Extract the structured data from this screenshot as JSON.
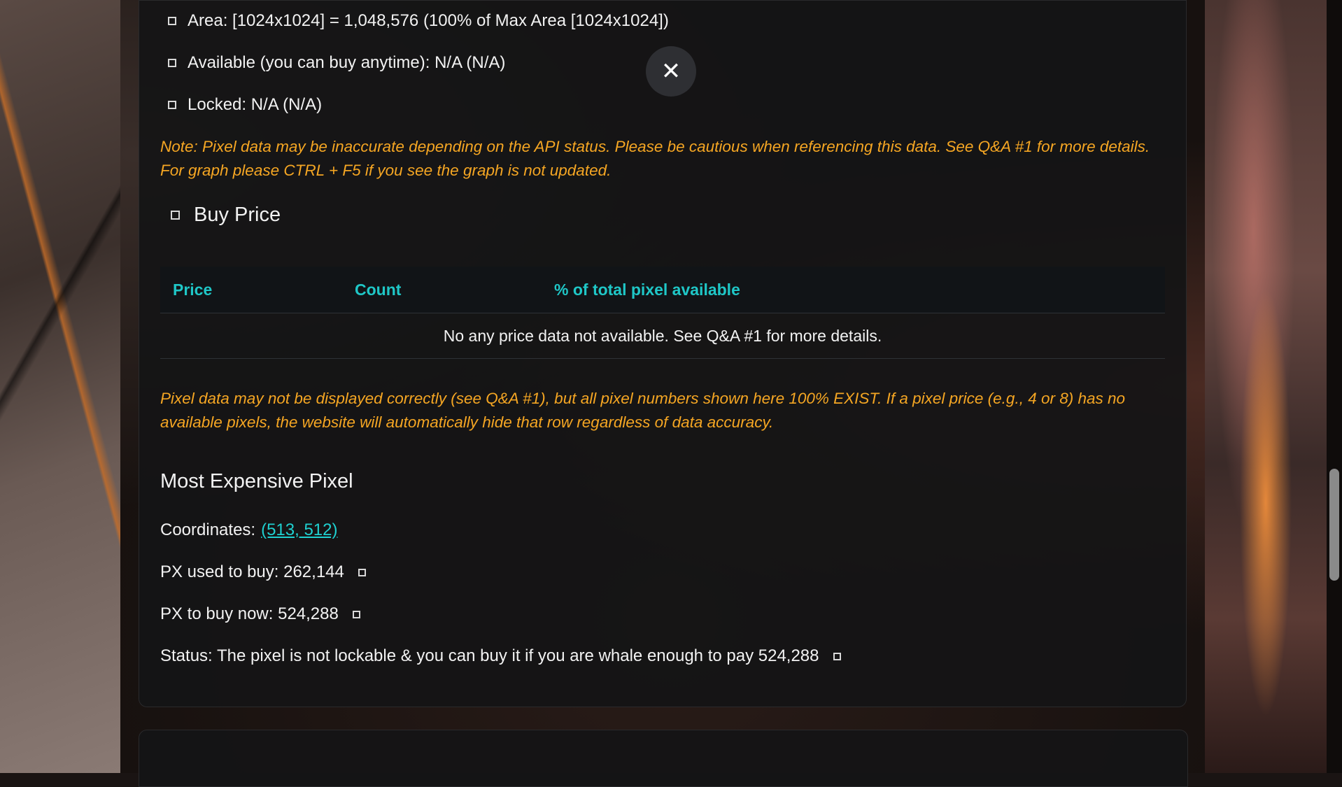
{
  "area_info": {
    "area": "Area: [1024x1024] = 1,048,576 (100% of Max Area [1024x1024])",
    "available": "Available (you can buy anytime): N/A (N/A)",
    "locked": "Locked: N/A (N/A)"
  },
  "close_button": {
    "icon": "close-icon",
    "glyph": "✕"
  },
  "notes": {
    "pixel_note": "Note: Pixel data may be inaccurate depending on the API status. Please be cautious when referencing this data. See Q&A #1 for more details. For graph please CTRL + F5 if you see the graph is not updated.",
    "display_note": "Pixel data may not be displayed correctly (see Q&A #1), but all pixel numbers shown here 100% EXIST. If a pixel price (e.g., 4 or 8) has no available pixels, the website will automatically hide that row regardless of data accuracy."
  },
  "buy_price": {
    "title": "Buy Price",
    "columns": [
      "Price",
      "Count",
      "% of total pixel available"
    ],
    "empty_message": "No any price data not available. See Q&A #1 for more details."
  },
  "most_expensive": {
    "title": "Most Expensive Pixel",
    "coordinates_label": "Coordinates:",
    "coordinates_value": "(513, 512)",
    "px_used": "PX used to buy: 262,144",
    "px_now": "PX to buy now: 524,288",
    "status": "Status: The pixel is not lockable & you can buy it if you are whale enough to pay 524,288"
  },
  "colors": {
    "accent": "#1fc7c7",
    "note": "#f5a623",
    "panel": "#141416"
  }
}
